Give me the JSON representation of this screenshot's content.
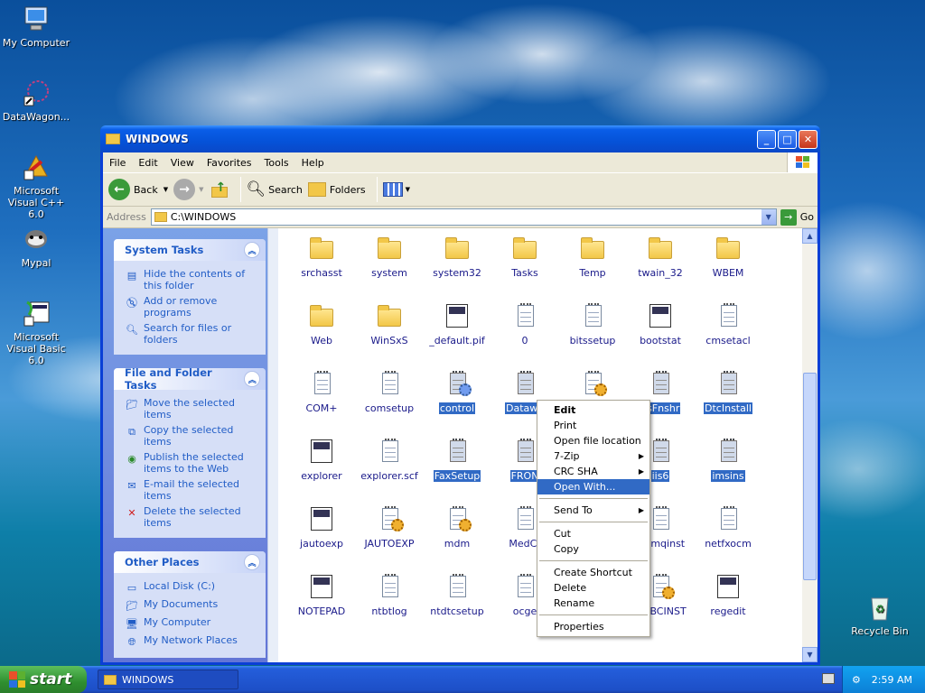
{
  "desktop": {
    "icons": [
      {
        "label": "My Computer"
      },
      {
        "label": "DataWagon..."
      },
      {
        "label": "Microsoft Visual C++ 6.0"
      },
      {
        "label": "Mypal"
      },
      {
        "label": "Microsoft Visual Basic 6.0"
      },
      {
        "label": "Recycle Bin"
      }
    ]
  },
  "window": {
    "title": "WINDOWS",
    "menu": [
      "File",
      "Edit",
      "View",
      "Favorites",
      "Tools",
      "Help"
    ],
    "toolbar": {
      "back": "Back",
      "search": "Search",
      "folders": "Folders"
    },
    "address": {
      "label": "Address",
      "value": "C:\\WINDOWS",
      "go": "Go"
    }
  },
  "taskpane": {
    "system_tasks": {
      "title": "System Tasks",
      "items": [
        "Hide the contents of this folder",
        "Add or remove programs",
        "Search for files or folders"
      ]
    },
    "file_folder_tasks": {
      "title": "File and Folder Tasks",
      "items": [
        "Move the selected items",
        "Copy the selected items",
        "Publish the selected items to the Web",
        "E-mail the selected items",
        "Delete the selected items"
      ]
    },
    "other_places": {
      "title": "Other Places",
      "items": [
        "Local Disk (C:)",
        "My Documents",
        "My Computer",
        "My Network Places"
      ]
    }
  },
  "files": [
    {
      "name": "srchasst",
      "kind": "folder",
      "selected": false
    },
    {
      "name": "system",
      "kind": "folder",
      "selected": false
    },
    {
      "name": "system32",
      "kind": "folder",
      "selected": false
    },
    {
      "name": "Tasks",
      "kind": "folder",
      "selected": false
    },
    {
      "name": "Temp",
      "kind": "folder",
      "selected": false
    },
    {
      "name": "twain_32",
      "kind": "folder",
      "selected": false
    },
    {
      "name": "WBEM",
      "kind": "folder",
      "selected": false
    },
    {
      "name": "Web",
      "kind": "folder",
      "selected": false
    },
    {
      "name": "WinSxS",
      "kind": "folder",
      "selected": false
    },
    {
      "name": "_default.pif",
      "kind": "app",
      "selected": false
    },
    {
      "name": "0",
      "kind": "doc",
      "selected": false
    },
    {
      "name": "bitssetup",
      "kind": "doc",
      "selected": false
    },
    {
      "name": "bootstat",
      "kind": "app",
      "selected": false
    },
    {
      "name": "cmsetacl",
      "kind": "doc",
      "selected": false
    },
    {
      "name": "COM+",
      "kind": "doc",
      "selected": false
    },
    {
      "name": "comsetup",
      "kind": "doc",
      "selected": false
    },
    {
      "name": "control",
      "kind": "gear",
      "selected": true
    },
    {
      "name": "Datawa",
      "kind": "doc",
      "selected": true
    },
    {
      "name": "",
      "kind": "gear",
      "selected": false
    },
    {
      "name": "PsFnshr",
      "kind": "doc",
      "selected": true
    },
    {
      "name": "DtcInstall",
      "kind": "doc",
      "selected": true
    },
    {
      "name": "explorer",
      "kind": "app",
      "selected": false
    },
    {
      "name": "explorer.scf",
      "kind": "doc",
      "selected": false
    },
    {
      "name": "FaxSetup",
      "kind": "doc",
      "selected": true
    },
    {
      "name": "FRON",
      "kind": "doc",
      "selected": true
    },
    {
      "name": "",
      "kind": "doc",
      "selected": false
    },
    {
      "name": "iis6",
      "kind": "doc",
      "selected": true
    },
    {
      "name": "imsins",
      "kind": "doc",
      "selected": true
    },
    {
      "name": "jautoexp",
      "kind": "app",
      "selected": false
    },
    {
      "name": "JAUTOEXP",
      "kind": "gear",
      "selected": false
    },
    {
      "name": "mdm",
      "kind": "gear",
      "selected": false
    },
    {
      "name": "MedCt",
      "kind": "doc",
      "selected": false
    },
    {
      "name": "",
      "kind": "doc",
      "selected": false
    },
    {
      "name": "msmqinst",
      "kind": "doc",
      "selected": false
    },
    {
      "name": "netfxocm",
      "kind": "doc",
      "selected": false
    },
    {
      "name": "NOTEPAD",
      "kind": "app",
      "selected": false
    },
    {
      "name": "ntbtlog",
      "kind": "doc",
      "selected": false
    },
    {
      "name": "ntdtcsetup",
      "kind": "doc",
      "selected": false
    },
    {
      "name": "ocge",
      "kind": "doc",
      "selected": false
    },
    {
      "name": "",
      "kind": "doc",
      "selected": false
    },
    {
      "name": "ODBCINST",
      "kind": "gear",
      "selected": false
    },
    {
      "name": "regedit",
      "kind": "app",
      "selected": false
    }
  ],
  "context_menu": {
    "items": [
      "Edit",
      "Print",
      "Open file location",
      "7-Zip",
      "CRC SHA",
      "Open With...",
      "Send To",
      "Cut",
      "Copy",
      "Create Shortcut",
      "Delete",
      "Rename",
      "Properties"
    ],
    "highlighted": "Open With..."
  },
  "taskbar": {
    "start": "start",
    "task": "WINDOWS",
    "clock": "2:59 AM"
  },
  "colors": {
    "selection": "#316ac5",
    "titlebar": "#0a5ee8",
    "taskpane_link": "#215dc6"
  }
}
